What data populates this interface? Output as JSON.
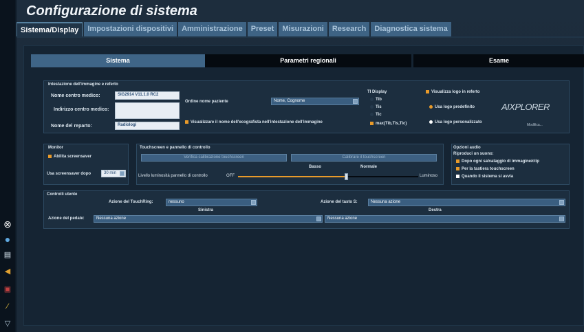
{
  "title": "Configurazione di sistema",
  "tabs": [
    "Sistema/Display",
    "Impostazioni dispositivi",
    "Amministrazione",
    "Preset",
    "Misurazioni",
    "Research",
    "Diagnostica sistema"
  ],
  "subtabs": [
    "Sistema",
    "Parametri regionali",
    "Esame"
  ],
  "header_section": {
    "title": "Intestazione dell'immagine e referto",
    "medical_center_label": "Nome centro medico:",
    "medical_center_value": "SIG2914 V11.1.0 RC2",
    "center_address_label": "Indirizzo centro medico:",
    "center_address_value": "",
    "department_label": "Nome del reparto:",
    "department_value": "Radiologi",
    "patient_order_label": "Ordine nome paziente",
    "patient_order_value": "Nome, Cognome",
    "show_sonographer_label": "Visualizzare il nome dell'ecografista nell'intestazione dell'immagine"
  },
  "ti_display": {
    "title": "TI Display",
    "options": [
      "Tib",
      "Tis",
      "Tic",
      "max(Tib,Tis,Tic)"
    ]
  },
  "logo": {
    "show_logo_label": "Visualizza logo in referto",
    "default_logo_label": "Usa logo predefinito",
    "custom_logo_label": "Usa logo personalizzato",
    "logo_text": "AIXPLORER",
    "modify_label": "Modifica..."
  },
  "monitor": {
    "title": "Monitor",
    "screensaver_label": "Abilita screensaver",
    "screensaver_after_label": "Usa screensaver dopo",
    "screensaver_value": "30 min"
  },
  "touchscreen": {
    "title": "Touchscreen e pannello di controllo",
    "verify_button": "Verifica calibrazione touchscreen",
    "calibrate_button": "Calibrare il touchscreen",
    "brightness_label": "Livello luminosità pannello di controllo",
    "off_label": "OFF",
    "low_label": "Basso",
    "normal_label": "Normale",
    "bright_label": "Luminoso",
    "level": 0.6
  },
  "audio": {
    "title": "Opzioni audio",
    "play_sound_label": "Riproduci un suono:",
    "options": [
      "Dopo ogni salvataggio di immagine/clip",
      "Per la tastiera touchscreen",
      "Quando il sistema si avvia"
    ]
  },
  "user_controls": {
    "title": "Controlli utente",
    "touchring_label": "Azione del TouchRing:",
    "touchring_value": "nessuno",
    "s_key_label": "Azione del tasto S:",
    "s_key_value": "Nessuna azione",
    "left_label": "Sinistra",
    "right_label": "Destra",
    "pedal_label": "Azione del pedale:",
    "pedal_left_value": "Nessuna azione",
    "pedal_right_value": "Nessuna azione"
  },
  "colors": {
    "accent": "#e89a2a",
    "tab": "#3e6384",
    "active_subtab": "#3f6587"
  }
}
